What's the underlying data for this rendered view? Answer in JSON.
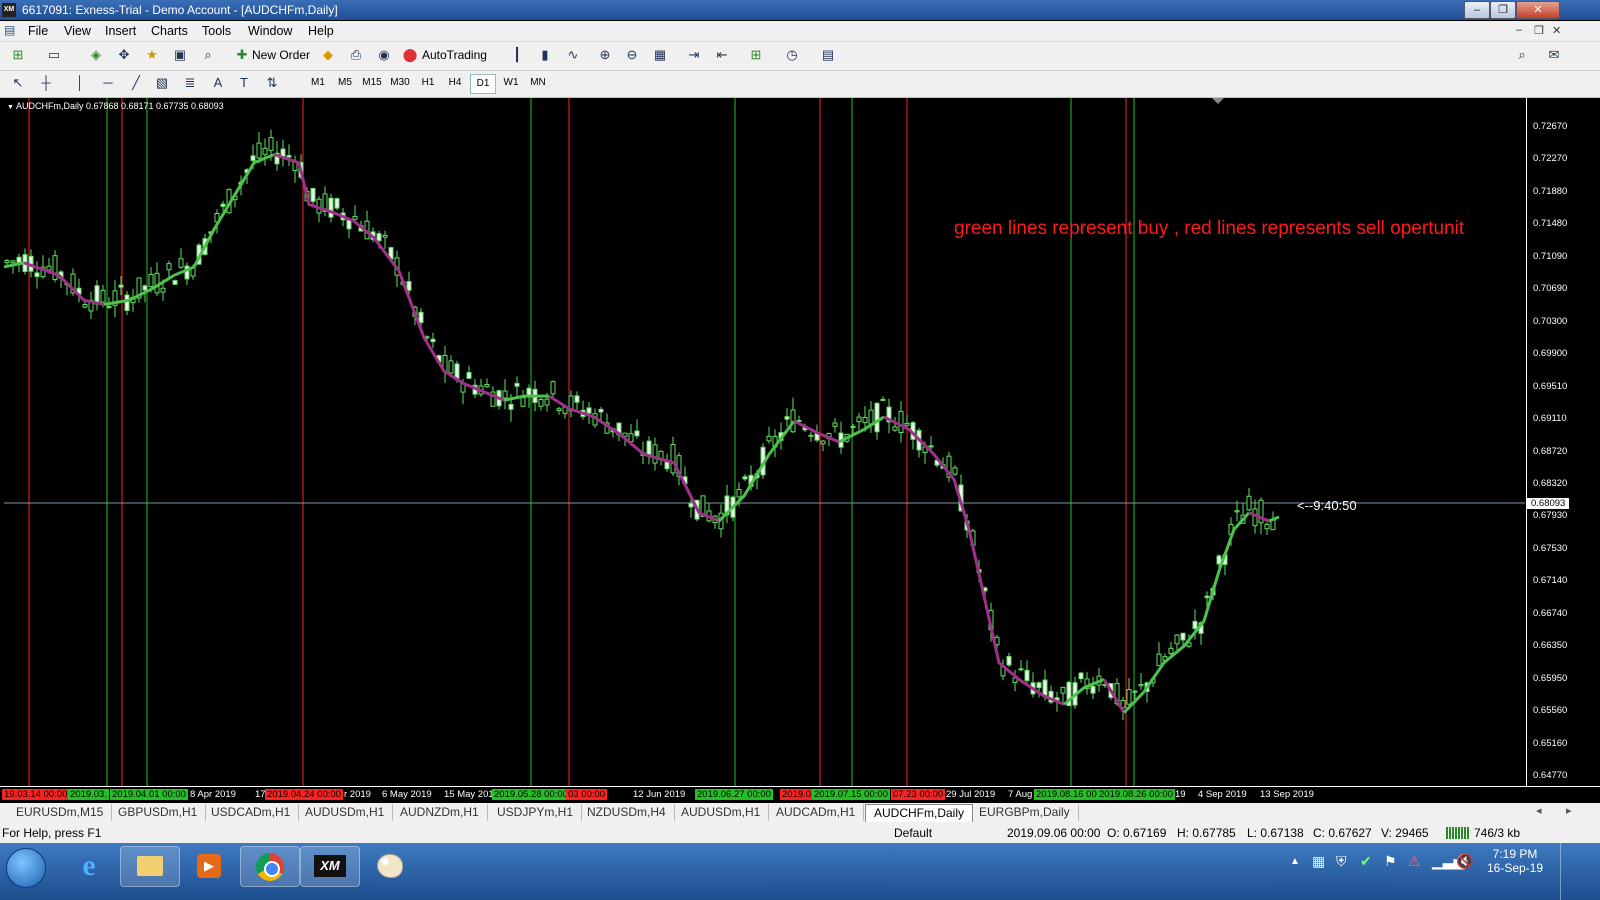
{
  "window": {
    "title": "6617091: Exness-Trial - Demo Account - [AUDCHFm,Daily]",
    "logo": "XM"
  },
  "menu": [
    "File",
    "View",
    "Insert",
    "Charts",
    "Tools",
    "Window",
    "Help"
  ],
  "toolbar": {
    "new_order": "New Order",
    "autotrading": "AutoTrading"
  },
  "timeframes": [
    "M1",
    "M5",
    "M15",
    "M30",
    "H1",
    "H4",
    "D1",
    "W1",
    "MN"
  ],
  "active_timeframe": "D1",
  "chart": {
    "header": "AUDCHFm,Daily  0.67868 0.68171 0.67735 0.68093",
    "annotation": "green lines represent buy , red lines represents sell opertunit",
    "countdown": "<--9:40:50",
    "current_price": "0.68093",
    "annotation_color": "#ff1a1a",
    "buy_line_color": "#22c022",
    "sell_line_color": "#ff2020",
    "price_labels": [
      "0.72670",
      "0.72270",
      "0.71880",
      "0.71480",
      "0.71090",
      "0.70690",
      "0.70300",
      "0.69900",
      "0.69510",
      "0.69110",
      "0.68720",
      "0.68320",
      "0.67930",
      "0.67530",
      "0.67140",
      "0.66740",
      "0.66350",
      "0.65950",
      "0.65560",
      "0.65160",
      "0.64770"
    ],
    "time_labels": [
      "19.03.14 00:00",
      "2019.03.",
      "2019.04.01 00:00",
      "8 Apr 2019",
      "17",
      "2019.04.24 00:00",
      "r 2019",
      "6 May 2019",
      "15 May 201",
      "2019.05.28 00:00",
      "03 00:00",
      "12 Jun 2019",
      "2019.06.27 00:00",
      "2019.0",
      "2019.07.15 00:00",
      "07.23 00:00",
      "29 Jul 2019",
      "7 Aug",
      "2019.08.16 00",
      "2019.08.26 00:00",
      "19",
      "4 Sep 2019",
      "13 Sep 2019"
    ]
  },
  "symbol_tabs": [
    "EURUSDm,M15",
    "GBPUSDm,H1",
    "USDCADm,H1",
    "AUDUSDm,H1",
    "AUDNZDm,H1",
    "USDJPYm,H1",
    "NZDUSDm,H4",
    "AUDUSDm,H1",
    "AUDCADm,H1",
    "AUDCHFm,Daily",
    "EURGBPm,Daily"
  ],
  "active_symbol_tab": "AUDCHFm,Daily",
  "status": {
    "help": "For Help, press F1",
    "profile": "Default",
    "datetime": "2019.09.06 00:00",
    "open": "O: 0.67169",
    "high": "H: 0.67785",
    "low": "L: 0.67138",
    "close": "C: 0.67627",
    "volume": "V: 29465",
    "traffic": "746/3 kb"
  },
  "taskbar": {
    "time": "7:19 PM",
    "date": "16-Sep-19"
  }
}
